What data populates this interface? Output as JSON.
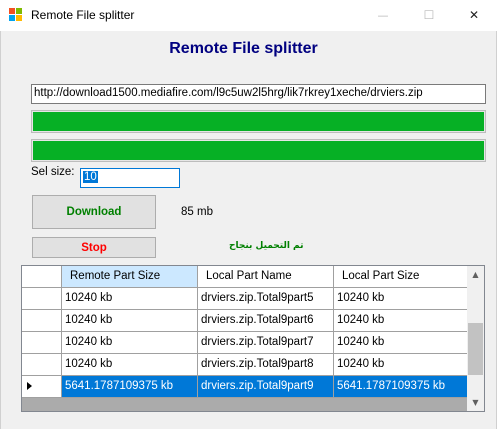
{
  "window": {
    "title": "Remote File splitter",
    "controls": {
      "minimize": "—",
      "maximize": "☐",
      "close": "✕"
    }
  },
  "form": {
    "heading": "Remote File splitter",
    "url": "http://download1500.mediafire.com/l9c5uw2l5hrg/lik7rkrey1xeche/drviers.zip",
    "progress1": 1.0,
    "progress2": 1.0,
    "sel_label": "Sel size:",
    "sel_value": "10",
    "download_label": "Download",
    "stop_label": "Stop",
    "size_text": "85 mb",
    "status_text": "تم التحميل بنجاح",
    "colors": {
      "progress": "#06b025",
      "heading": "#000080",
      "download": "#008000",
      "stop": "#ff0000",
      "selected_row": "#0078d7"
    }
  },
  "grid": {
    "columns": [
      "Remote Part Size",
      "Local Part Name",
      "Local Part Size"
    ],
    "rows": [
      [
        "10240 kb",
        "drviers.zip.Total9part5",
        "10240 kb"
      ],
      [
        "10240 kb",
        "drviers.zip.Total9part6",
        "10240 kb"
      ],
      [
        "10240 kb",
        "drviers.zip.Total9part7",
        "10240 kb"
      ],
      [
        "10240 kb",
        "drviers.zip.Total9part8",
        "10240 kb"
      ],
      [
        "5641.1787109375 kb",
        "drviers.zip.Total9part9",
        "5641.1787109375 kb"
      ]
    ],
    "selected_row": 4
  }
}
